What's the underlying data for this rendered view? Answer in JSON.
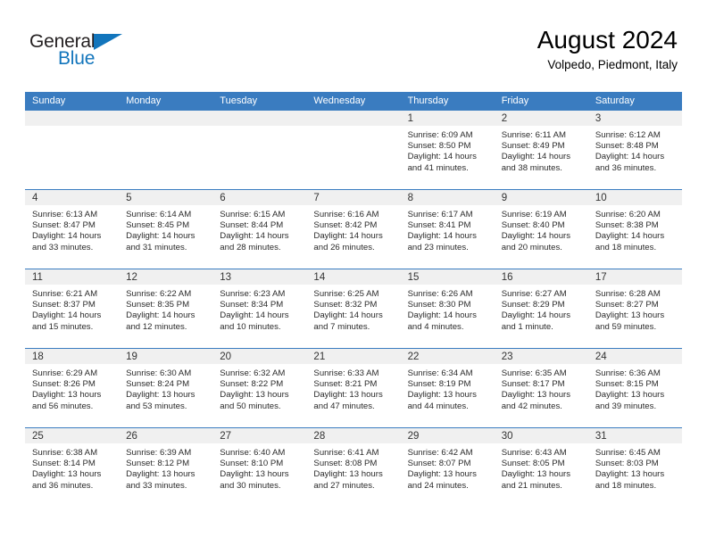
{
  "brand": {
    "name_part1": "General",
    "name_part2": "Blue",
    "accent_color": "#1275bc",
    "triangle_icon": "logo-triangle-icon"
  },
  "header": {
    "title": "August 2024",
    "subtitle": "Volpedo, Piedmont, Italy"
  },
  "calendar": {
    "header_bg": "#3a7cc0",
    "day_band_bg": "#f0f0f0",
    "weekday_headers": [
      "Sunday",
      "Monday",
      "Tuesday",
      "Wednesday",
      "Thursday",
      "Friday",
      "Saturday"
    ],
    "weeks": [
      [
        {
          "day": "",
          "sunrise": "",
          "sunset": "",
          "daylight": "",
          "empty": true
        },
        {
          "day": "",
          "sunrise": "",
          "sunset": "",
          "daylight": "",
          "empty": true
        },
        {
          "day": "",
          "sunrise": "",
          "sunset": "",
          "daylight": "",
          "empty": true
        },
        {
          "day": "",
          "sunrise": "",
          "sunset": "",
          "daylight": "",
          "empty": true
        },
        {
          "day": "1",
          "sunrise": "Sunrise: 6:09 AM",
          "sunset": "Sunset: 8:50 PM",
          "daylight": "Daylight: 14 hours and 41 minutes."
        },
        {
          "day": "2",
          "sunrise": "Sunrise: 6:11 AM",
          "sunset": "Sunset: 8:49 PM",
          "daylight": "Daylight: 14 hours and 38 minutes."
        },
        {
          "day": "3",
          "sunrise": "Sunrise: 6:12 AM",
          "sunset": "Sunset: 8:48 PM",
          "daylight": "Daylight: 14 hours and 36 minutes."
        }
      ],
      [
        {
          "day": "4",
          "sunrise": "Sunrise: 6:13 AM",
          "sunset": "Sunset: 8:47 PM",
          "daylight": "Daylight: 14 hours and 33 minutes."
        },
        {
          "day": "5",
          "sunrise": "Sunrise: 6:14 AM",
          "sunset": "Sunset: 8:45 PM",
          "daylight": "Daylight: 14 hours and 31 minutes."
        },
        {
          "day": "6",
          "sunrise": "Sunrise: 6:15 AM",
          "sunset": "Sunset: 8:44 PM",
          "daylight": "Daylight: 14 hours and 28 minutes."
        },
        {
          "day": "7",
          "sunrise": "Sunrise: 6:16 AM",
          "sunset": "Sunset: 8:42 PM",
          "daylight": "Daylight: 14 hours and 26 minutes."
        },
        {
          "day": "8",
          "sunrise": "Sunrise: 6:17 AM",
          "sunset": "Sunset: 8:41 PM",
          "daylight": "Daylight: 14 hours and 23 minutes."
        },
        {
          "day": "9",
          "sunrise": "Sunrise: 6:19 AM",
          "sunset": "Sunset: 8:40 PM",
          "daylight": "Daylight: 14 hours and 20 minutes."
        },
        {
          "day": "10",
          "sunrise": "Sunrise: 6:20 AM",
          "sunset": "Sunset: 8:38 PM",
          "daylight": "Daylight: 14 hours and 18 minutes."
        }
      ],
      [
        {
          "day": "11",
          "sunrise": "Sunrise: 6:21 AM",
          "sunset": "Sunset: 8:37 PM",
          "daylight": "Daylight: 14 hours and 15 minutes."
        },
        {
          "day": "12",
          "sunrise": "Sunrise: 6:22 AM",
          "sunset": "Sunset: 8:35 PM",
          "daylight": "Daylight: 14 hours and 12 minutes."
        },
        {
          "day": "13",
          "sunrise": "Sunrise: 6:23 AM",
          "sunset": "Sunset: 8:34 PM",
          "daylight": "Daylight: 14 hours and 10 minutes."
        },
        {
          "day": "14",
          "sunrise": "Sunrise: 6:25 AM",
          "sunset": "Sunset: 8:32 PM",
          "daylight": "Daylight: 14 hours and 7 minutes."
        },
        {
          "day": "15",
          "sunrise": "Sunrise: 6:26 AM",
          "sunset": "Sunset: 8:30 PM",
          "daylight": "Daylight: 14 hours and 4 minutes."
        },
        {
          "day": "16",
          "sunrise": "Sunrise: 6:27 AM",
          "sunset": "Sunset: 8:29 PM",
          "daylight": "Daylight: 14 hours and 1 minute."
        },
        {
          "day": "17",
          "sunrise": "Sunrise: 6:28 AM",
          "sunset": "Sunset: 8:27 PM",
          "daylight": "Daylight: 13 hours and 59 minutes."
        }
      ],
      [
        {
          "day": "18",
          "sunrise": "Sunrise: 6:29 AM",
          "sunset": "Sunset: 8:26 PM",
          "daylight": "Daylight: 13 hours and 56 minutes."
        },
        {
          "day": "19",
          "sunrise": "Sunrise: 6:30 AM",
          "sunset": "Sunset: 8:24 PM",
          "daylight": "Daylight: 13 hours and 53 minutes."
        },
        {
          "day": "20",
          "sunrise": "Sunrise: 6:32 AM",
          "sunset": "Sunset: 8:22 PM",
          "daylight": "Daylight: 13 hours and 50 minutes."
        },
        {
          "day": "21",
          "sunrise": "Sunrise: 6:33 AM",
          "sunset": "Sunset: 8:21 PM",
          "daylight": "Daylight: 13 hours and 47 minutes."
        },
        {
          "day": "22",
          "sunrise": "Sunrise: 6:34 AM",
          "sunset": "Sunset: 8:19 PM",
          "daylight": "Daylight: 13 hours and 44 minutes."
        },
        {
          "day": "23",
          "sunrise": "Sunrise: 6:35 AM",
          "sunset": "Sunset: 8:17 PM",
          "daylight": "Daylight: 13 hours and 42 minutes."
        },
        {
          "day": "24",
          "sunrise": "Sunrise: 6:36 AM",
          "sunset": "Sunset: 8:15 PM",
          "daylight": "Daylight: 13 hours and 39 minutes."
        }
      ],
      [
        {
          "day": "25",
          "sunrise": "Sunrise: 6:38 AM",
          "sunset": "Sunset: 8:14 PM",
          "daylight": "Daylight: 13 hours and 36 minutes."
        },
        {
          "day": "26",
          "sunrise": "Sunrise: 6:39 AM",
          "sunset": "Sunset: 8:12 PM",
          "daylight": "Daylight: 13 hours and 33 minutes."
        },
        {
          "day": "27",
          "sunrise": "Sunrise: 6:40 AM",
          "sunset": "Sunset: 8:10 PM",
          "daylight": "Daylight: 13 hours and 30 minutes."
        },
        {
          "day": "28",
          "sunrise": "Sunrise: 6:41 AM",
          "sunset": "Sunset: 8:08 PM",
          "daylight": "Daylight: 13 hours and 27 minutes."
        },
        {
          "day": "29",
          "sunrise": "Sunrise: 6:42 AM",
          "sunset": "Sunset: 8:07 PM",
          "daylight": "Daylight: 13 hours and 24 minutes."
        },
        {
          "day": "30",
          "sunrise": "Sunrise: 6:43 AM",
          "sunset": "Sunset: 8:05 PM",
          "daylight": "Daylight: 13 hours and 21 minutes."
        },
        {
          "day": "31",
          "sunrise": "Sunrise: 6:45 AM",
          "sunset": "Sunset: 8:03 PM",
          "daylight": "Daylight: 13 hours and 18 minutes."
        }
      ]
    ]
  }
}
